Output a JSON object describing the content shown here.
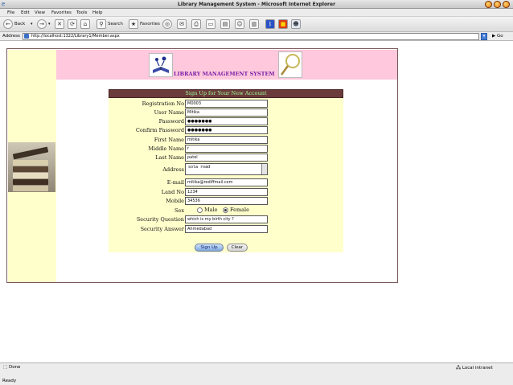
{
  "window": {
    "title": "Library Management System - Microsoft Internet Explorer"
  },
  "menu": {
    "items": [
      "File",
      "Edit",
      "View",
      "Favorites",
      "Tools",
      "Help"
    ]
  },
  "toolbar": {
    "back_label": "Back",
    "search_label": "Search",
    "favorites_label": "Favorites"
  },
  "address": {
    "label": "Address",
    "url": "http://localhost:1322/Library1/Member.aspx",
    "go_label": "Go"
  },
  "page": {
    "app_title": "LIBRARY MANAGEMENT SYSTEM",
    "form_title": "Sign Up for Your New Account",
    "fields": {
      "registration_no": {
        "label": "Registration No",
        "value": "M0003"
      },
      "user_name": {
        "label": "User Name",
        "value": "Mitika"
      },
      "password": {
        "label": "Password",
        "value": "●●●●●●●"
      },
      "confirm_password": {
        "label": "Confirm Password",
        "value": "●●●●●●●"
      },
      "first_name": {
        "label": "First Name",
        "value": "mitika"
      },
      "middle_name": {
        "label": "Middle Name",
        "value": "r"
      },
      "last_name": {
        "label": "Last Name",
        "value": "patel"
      },
      "address": {
        "label": "Address",
        "value": "sola road"
      },
      "email": {
        "label": "E-mail",
        "value": "mitika@rediffmail.com"
      },
      "land_no": {
        "label": "Land No",
        "value": "1234"
      },
      "mobile": {
        "label": "Mobile",
        "value": "34536"
      },
      "sex": {
        "label": "Sex",
        "options": [
          "Male",
          "Female"
        ],
        "selected": "Female"
      },
      "security_question": {
        "label": "Security Question",
        "value": "which is my birth city ?"
      },
      "security_answer": {
        "label": "Security Answer",
        "value": "Ahmedabad"
      }
    },
    "buttons": {
      "sign_up": "Sign Up",
      "clear": "Clear"
    }
  },
  "statusbar": {
    "status": "Done",
    "zone": "Local intranet",
    "ready": "Ready"
  },
  "colors": {
    "header_bg": "#ffc8dc",
    "form_bg": "#ffffcc",
    "form_head_bg": "#6b3a3a",
    "form_head_text": "#9cff9c",
    "app_title_color": "#7a1fa8"
  }
}
